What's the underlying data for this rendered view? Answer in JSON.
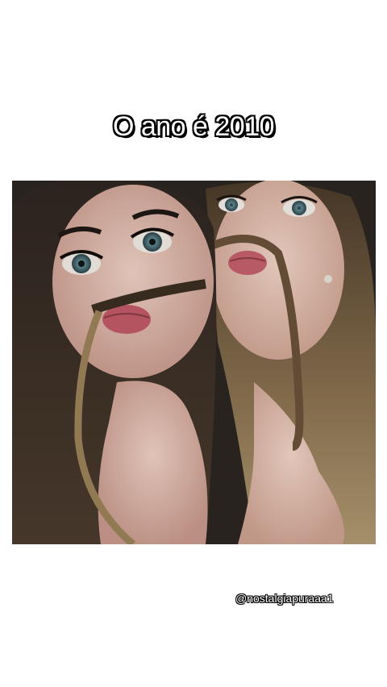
{
  "caption": {
    "text": "O ano é 2010"
  },
  "photo": {
    "subject": "two-girls-mustache-selfie"
  },
  "watermark": {
    "text": "@nostalgiapuraaa1"
  },
  "colors": {
    "background": "#ffffff",
    "caption_fill": "#ffffff",
    "caption_outline": "#000000"
  }
}
